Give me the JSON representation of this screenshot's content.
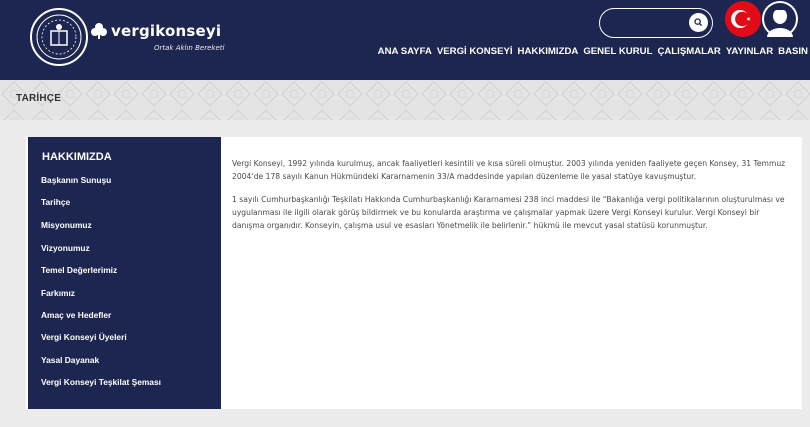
{
  "brand": {
    "name": "vergikonseyi",
    "tagline": "Ortak Aklın Bereketi"
  },
  "search": {
    "value": "",
    "placeholder": ""
  },
  "nav": {
    "items": [
      "ANA SAYFA",
      "VERGİ KONSEYİ",
      "HAKKIMIZDA",
      "GENEL KURUL",
      "ÇALIŞMALAR",
      "YAYINLAR",
      "BASIN"
    ]
  },
  "breadcrumb": {
    "title": "TARİHÇE"
  },
  "sidebar": {
    "title": "HAKKIMIZDA",
    "items": [
      "Başkanın Sunuşu",
      "Tarihçe",
      "Misyonumuz",
      "Vizyonumuz",
      "Temel Değerlerimiz",
      "Farkımız",
      "Amaç ve Hedefler",
      "Vergi Konseyi Üyeleri",
      "Yasal Dayanak",
      "Vergi Konseyi Teşkilat Şeması"
    ]
  },
  "content": {
    "paragraphs": [
      "Vergi Konseyi, 1992 yılında kurulmuş, ancak faaliyetleri kesintili ve kısa süreli olmuştur. 2003 yılında yeniden faaliyete geçen Konsey, 31 Temmuz 2004’de 178 sayılı Kanun Hükmündeki Kararnamenin 33/A maddesinde yapılan düzenleme ile yasal statüye kavuşmuştur.",
      "1 sayılı Cumhurbaşkanlığı Teşkilatı Hakkında Cumhurbaşkanlığı Kararnamesi 238 inci maddesi ile “Bakanlığa vergi politikalarının oluşturulması ve uygulanması ile ilgili olarak görüş bildirmek ve bu konularda araştırma ve çalışmalar yapmak üzere Vergi Konseyi kurulur. Vergi Konseyi bir danışma organıdır. Konseyin, çalışma usul ve esasları Yönetmelik ile belirlenir.” hükmü ile mevcut yasal statüsü korunmuştur."
    ]
  },
  "colors": {
    "navy": "#1d2650",
    "flag_red": "#e30a17",
    "white": "#ffffff"
  },
  "icons": {
    "seal": "tax-council-seal-icon",
    "brand_mark": "clover-icon",
    "search": "search-icon",
    "flag": "turkish-flag-icon",
    "portrait": "ataturk-portrait-icon"
  }
}
